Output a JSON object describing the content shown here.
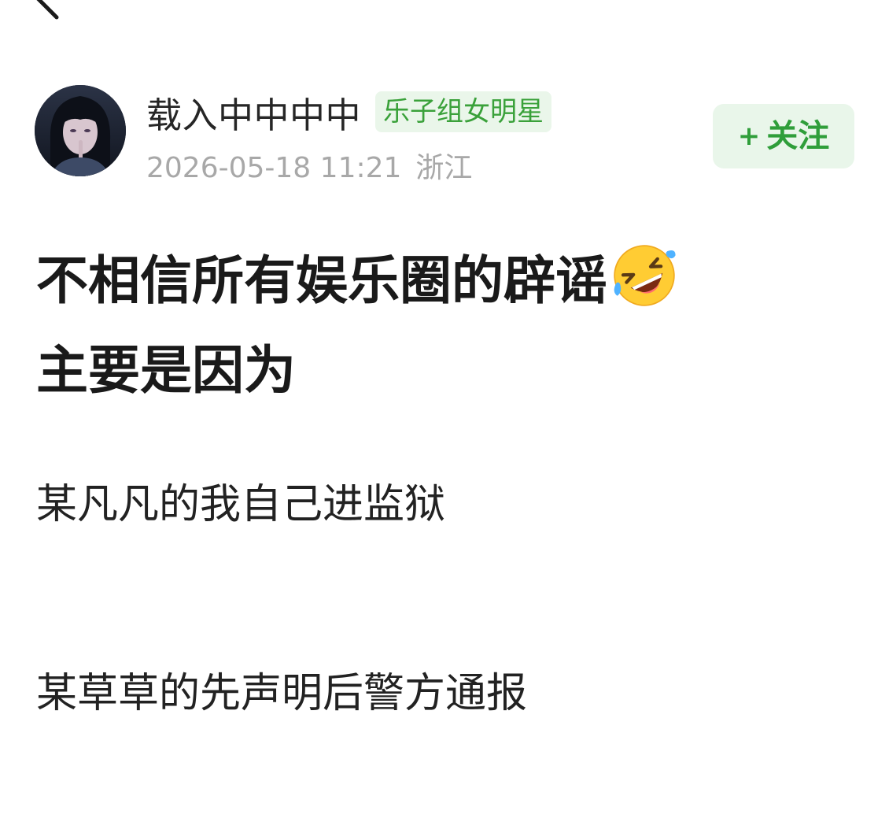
{
  "nav": {
    "back_icon": "back-arrow-icon"
  },
  "author": {
    "avatar_icon": "user-avatar",
    "name": "载入中中中中",
    "tag": "乐子组女明星",
    "timestamp": "2026-05-18 11:21",
    "location": "浙江"
  },
  "follow": {
    "plus": "+",
    "label": "关注"
  },
  "post": {
    "title_line1": "不相信所有娱乐圈的辟谣",
    "title_emoji": "rolling-on-floor-laughing-emoji",
    "title_line2": "主要是因为",
    "paragraphs": [
      "某凡凡的我自己进监狱",
      "某草草的先声明后警方通报"
    ]
  },
  "colors": {
    "accent_green": "#2f9e3a",
    "tag_green": "#3aa13a",
    "tag_bg": "#eaf6ea",
    "meta_gray": "#a8a8a8"
  }
}
